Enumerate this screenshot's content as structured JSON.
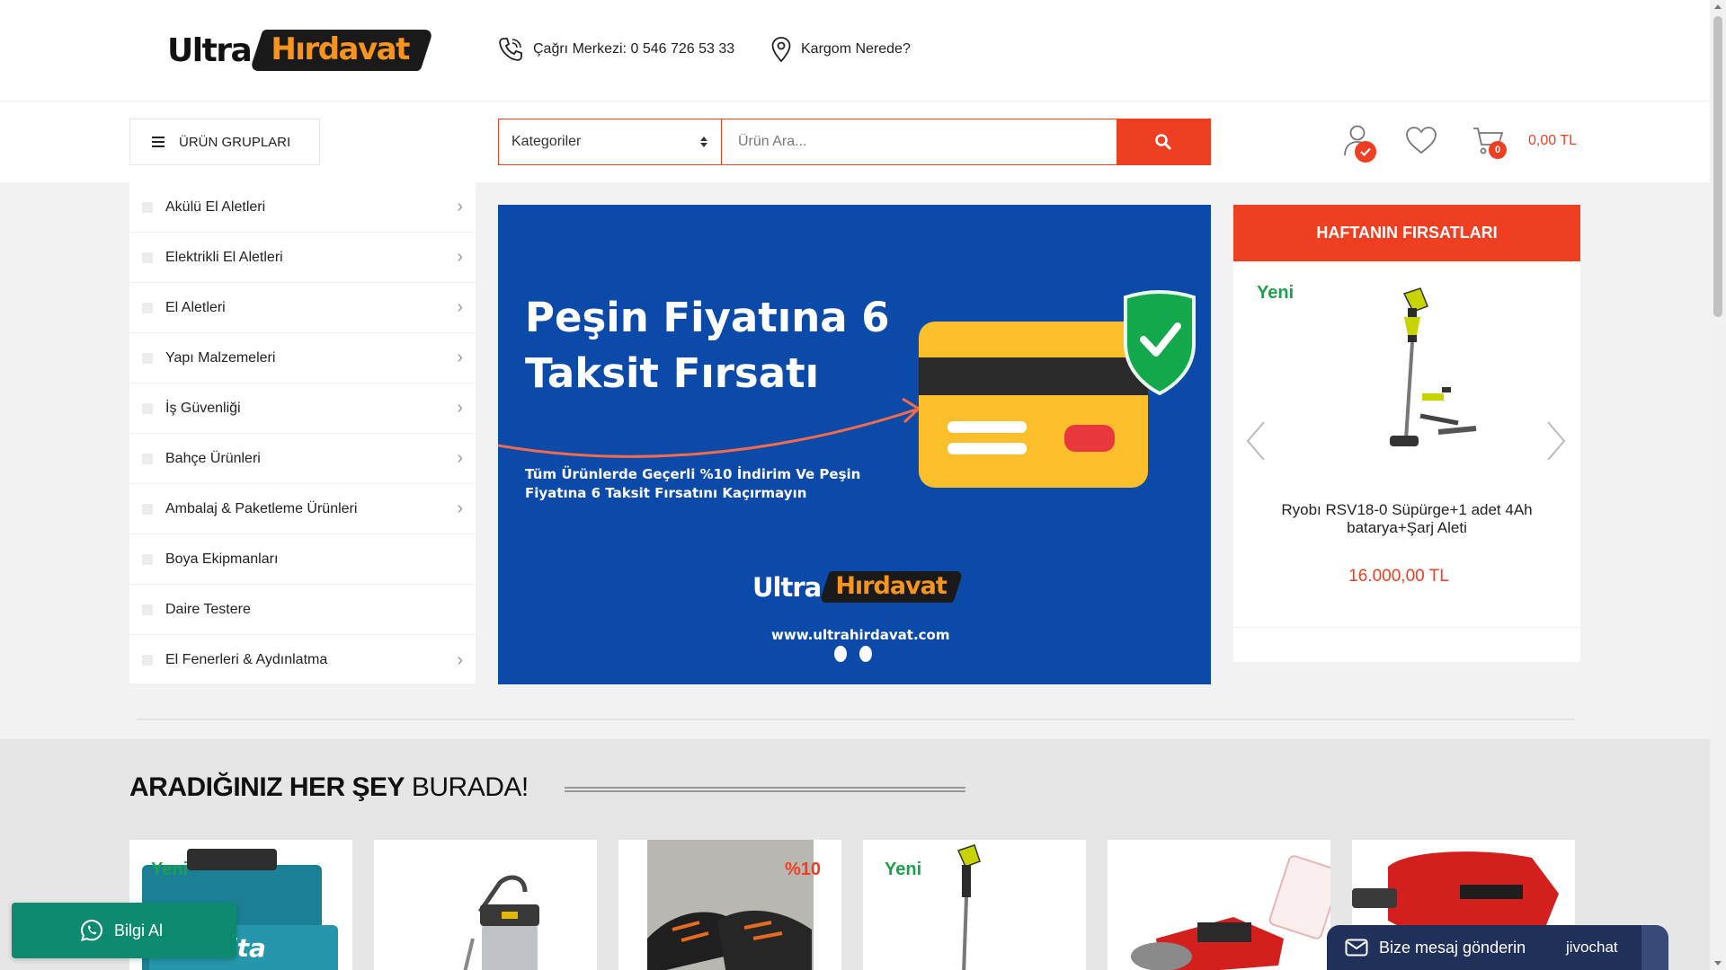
{
  "brand": {
    "logo_ultra": "Ultra",
    "logo_hirdavat": "Hırdavat",
    "accent": "#ee3f23",
    "logo_orange": "#f7941d",
    "new_green": "#1aa34a"
  },
  "header": {
    "call_center": "Çağrı Merkezi: 0 546 726 53 33",
    "cargo": "Kargom Nerede?"
  },
  "nav": {
    "categories_button": "ÜRÜN GRUPLARI",
    "search_select": "Kategoriler",
    "search_placeholder": "Ürün Ara...",
    "cart_count": "0",
    "cart_total": "0,00 TL"
  },
  "sidebar": {
    "items": [
      {
        "label": "Akülü El Aletleri",
        "has_sub": true
      },
      {
        "label": "Elektrikli El Aletleri",
        "has_sub": true
      },
      {
        "label": "El Aletleri",
        "has_sub": true
      },
      {
        "label": "Yapı Malzemeleri",
        "has_sub": true
      },
      {
        "label": "İş Güvenliği",
        "has_sub": true
      },
      {
        "label": "Bahçe Ürünleri",
        "has_sub": true
      },
      {
        "label": "Ambalaj & Paketleme Ürünleri",
        "has_sub": true
      },
      {
        "label": "Boya Ekipmanları",
        "has_sub": false
      },
      {
        "label": "Daire Testere",
        "has_sub": false
      },
      {
        "label": "El Fenerleri & Aydınlatma",
        "has_sub": true
      }
    ]
  },
  "banner": {
    "title_line1": "Peşin Fiyatına 6",
    "title_line2": "Taksit Fırsatı",
    "subtitle_line1": "Tüm Ürünlerde Geçerli %10 İndirim Ve Peşin",
    "subtitle_line2": "Fiyatına 6 Taksit Fırsatını Kaçırmayın",
    "logo_ultra": "Ultra",
    "logo_hirdavat": "Hırdavat",
    "url": "www.ultrahirdavat.com",
    "bg_color": "#0b4aa9"
  },
  "deals": {
    "title": "HAFTANIN FIRSATLARI",
    "badge": "Yeni",
    "product_name": "Ryobı RSV18-0 Süpürge+1 adet 4Ah batarya+Şarj Aleti",
    "price": "16.000,00 TL"
  },
  "section": {
    "title_bold": "ARADIĞINIZ HER ŞEY",
    "title_rest": "BURADA!"
  },
  "products": [
    {
      "tag": "Yeni",
      "icon": "makita-case-icon"
    },
    {
      "tag": "",
      "icon": "vacuum-icon"
    },
    {
      "tag": "%10",
      "icon": "safety-shoes-icon"
    },
    {
      "tag": "Yeni",
      "icon": "stick-vacuum-icon"
    },
    {
      "tag": "",
      "icon": "angle-grinder-icon"
    },
    {
      "tag": "",
      "icon": "rotary-hammer-icon"
    }
  ],
  "widgets": {
    "whatsapp": "Bilgi Al",
    "chat": "Bize mesaj gönderin",
    "chat_brand": "jivochat"
  }
}
